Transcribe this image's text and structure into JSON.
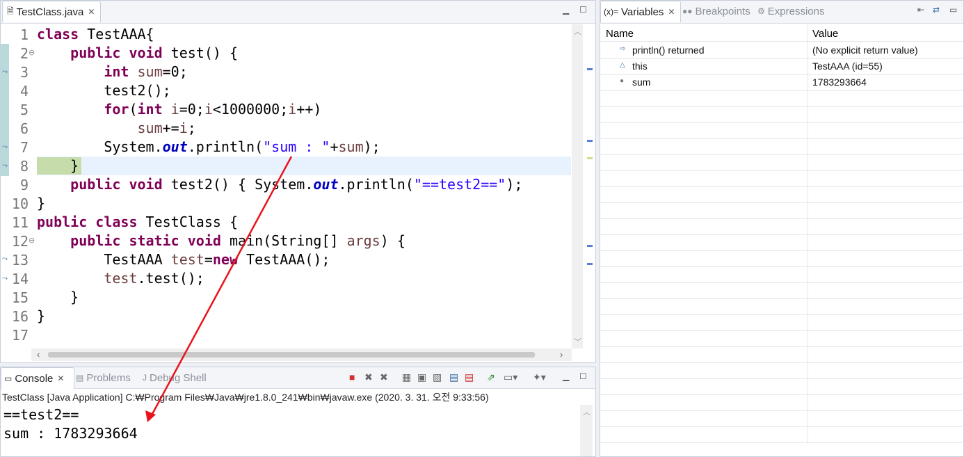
{
  "editor": {
    "tab_label": "TestClass.java",
    "lines": [
      {
        "n": "1",
        "html_key": "l1"
      },
      {
        "n": "2"
      },
      {
        "n": "3"
      },
      {
        "n": "4"
      },
      {
        "n": "5"
      },
      {
        "n": "6"
      },
      {
        "n": "7"
      },
      {
        "n": "8"
      },
      {
        "n": "9"
      },
      {
        "n": "10"
      },
      {
        "n": "11"
      },
      {
        "n": "12"
      },
      {
        "n": "13"
      },
      {
        "n": "14"
      },
      {
        "n": "15"
      },
      {
        "n": "16"
      },
      {
        "n": "17"
      }
    ],
    "code": {
      "l1a": "class",
      "l1b": " TestAAA{",
      "l2a": "    ",
      "l2b": "public",
      "l2c": " ",
      "l2d": "void",
      "l2e": " test() {",
      "l3a": "        ",
      "l3b": "int",
      "l3c": " ",
      "l3d": "sum",
      "l3e": "=0;",
      "l4": "        test2();",
      "l5a": "        ",
      "l5b": "for",
      "l5c": "(",
      "l5d": "int",
      "l5e": " ",
      "l5f": "i",
      "l5g": "=0;",
      "l5h": "i",
      "l5i": "<1000000;",
      "l5j": "i",
      "l5k": "++)",
      "l6a": "            ",
      "l6b": "sum",
      "l6c": "+=",
      "l6d": "i",
      "l6e": ";",
      "l7a": "        System.",
      "l7b": "out",
      "l7c": ".println(",
      "l7d": "\"sum : \"",
      "l7e": "+",
      "l7f": "sum",
      "l7g": ");",
      "l8": "    }",
      "l9a": "    ",
      "l9b": "public",
      "l9c": " ",
      "l9d": "void",
      "l9e": " test2() { System.",
      "l9f": "out",
      "l9g": ".println(",
      "l9h": "\"==test2==\"",
      "l9i": ");",
      "l10": "}",
      "l11a": "public",
      "l11b": " ",
      "l11c": "class",
      "l11d": " TestClass {",
      "l12a": "    ",
      "l12b": "public",
      "l12c": " ",
      "l12d": "static",
      "l12e": " ",
      "l12f": "void",
      "l12g": " main(String[] ",
      "l12h": "args",
      "l12i": ") {",
      "l13a": "        TestAAA ",
      "l13b": "test",
      "l13c": "=",
      "l13d": "new",
      "l13e": " TestAAA();",
      "l14a": "        ",
      "l14b": "test",
      "l14c": ".test();",
      "l15": "    }",
      "l16": "}",
      "l17": ""
    }
  },
  "variables": {
    "tab_variables": "Variables",
    "tab_breakpoints": "Breakpoints",
    "tab_expressions": "Expressions",
    "col_name": "Name",
    "col_value": "Value",
    "rows": [
      {
        "name": "println() returned",
        "value": "(No explicit return value)",
        "icon": "return-icon"
      },
      {
        "name": "this",
        "value": "TestAAA  (id=55)",
        "icon": "field-icon"
      },
      {
        "name": "sum",
        "value": "1783293664",
        "icon": "local-var-icon"
      }
    ]
  },
  "console": {
    "tab_console": "Console",
    "tab_problems": "Problems",
    "tab_debug_shell": "Debug Shell",
    "process_label": "TestClass [Java Application] C:₩Program Files₩Java₩jre1.8.0_241₩bin₩javaw.exe (2020. 3. 31. 오전 9:33:56)",
    "output_line1": "==test2==",
    "output_line2": "sum : 1783293664"
  },
  "colors": {
    "keyword": "#7f0055",
    "string": "#2a00ff",
    "field": "#0000c0",
    "local": "#6a3e3e",
    "arrow": "#e8131b"
  }
}
